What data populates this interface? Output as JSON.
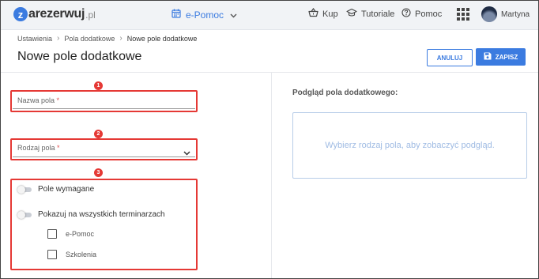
{
  "app": {
    "logo_letter": "z",
    "logo_text": "arezerwuj",
    "logo_suffix": ".pl"
  },
  "calendar_switch": {
    "label": "e-Pomoc"
  },
  "topnav": {
    "buy": "Kup",
    "tutorials": "Tutoriale",
    "help": "Pomoc"
  },
  "user": {
    "name": "Martyna"
  },
  "breadcrumb": {
    "items": [
      "Ustawienia",
      "Pola dodatkowe",
      "Nowe pole dodatkowe"
    ]
  },
  "page": {
    "title": "Nowe pole dodatkowe"
  },
  "buttons": {
    "cancel": "ANULUJ",
    "save": "ZAPISZ"
  },
  "form": {
    "name_field": {
      "label": "Nazwa pola",
      "required_mark": "*",
      "value": ""
    },
    "type_field": {
      "label": "Rodzaj pola",
      "required_mark": "*",
      "selected": ""
    },
    "required_toggle": {
      "label": "Pole wymagane",
      "on": false
    },
    "show_all_toggle": {
      "label": "Pokazuj na wszystkich terminarzach",
      "on": false
    },
    "calendars": [
      {
        "label": "e-Pomoc",
        "checked": false
      },
      {
        "label": "Szkolenia",
        "checked": false
      }
    ]
  },
  "annotations": {
    "badges": [
      "1",
      "2",
      "3"
    ],
    "color": "#e53935"
  },
  "preview": {
    "title": "Podgląd pola dodatkowego:",
    "placeholder": "Wybierz rodzaj pola, aby zobaczyć podgląd."
  },
  "colors": {
    "accent": "#3b7be0",
    "topbar": "#f1f3f6"
  },
  "icons": [
    "calendar-icon",
    "chevron-down-icon",
    "basket-icon",
    "graduation-cap-icon",
    "help-circle-icon",
    "apps-grid-icon",
    "floppy-disk-icon",
    "avatar"
  ]
}
